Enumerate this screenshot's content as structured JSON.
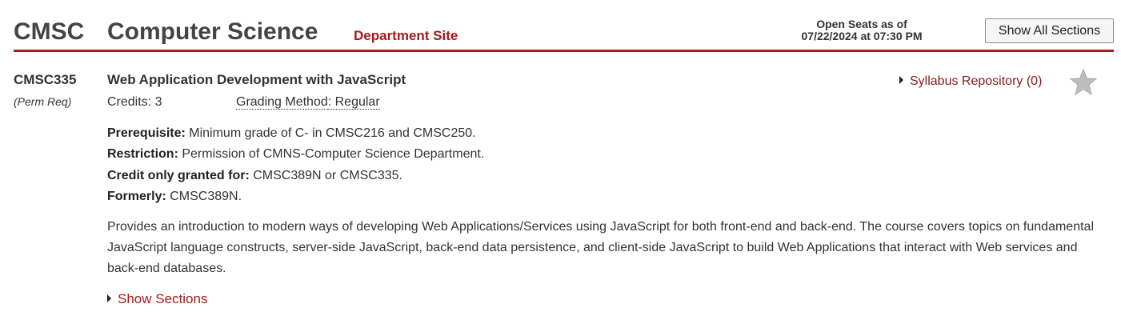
{
  "department": {
    "code": "CMSC",
    "name": "Computer Science",
    "site_link": "Department Site"
  },
  "open_seats": {
    "line1": "Open Seats as of",
    "line2": "07/22/2024 at 07:30 PM"
  },
  "show_all_label": "Show All Sections",
  "course": {
    "id": "CMSC335",
    "perm_req": "(Perm Req)",
    "title": "Web Application Development with JavaScript",
    "credits": "Credits: 3",
    "grading_label": "Grading Method",
    "grading_value": ": Regular",
    "syllabus_link": "Syllabus Repository (0)",
    "requirements": [
      {
        "label": "Prerequisite:",
        "text": " Minimum grade of C- in CMSC216 and CMSC250."
      },
      {
        "label": "Restriction:",
        "text": " Permission of CMNS-Computer Science Department."
      },
      {
        "label": "Credit only granted for:",
        "text": " CMSC389N or CMSC335."
      },
      {
        "label": "Formerly:",
        "text": " CMSC389N."
      }
    ],
    "description": "Provides an introduction to modern ways of developing Web Applications/Services using JavaScript for both front-end and back-end. The course covers topics on fundamental JavaScript language constructs, server-side JavaScript, back-end data persistence, and client-side JavaScript to build Web Applications that interact with Web services and back-end databases.",
    "show_sections": "Show Sections"
  },
  "colors": {
    "accent": "#a51c1c",
    "text": "#333333",
    "star": "#bdbdbd"
  },
  "icons": {
    "favorite": "star-icon",
    "expand": "caret-right-icon"
  }
}
